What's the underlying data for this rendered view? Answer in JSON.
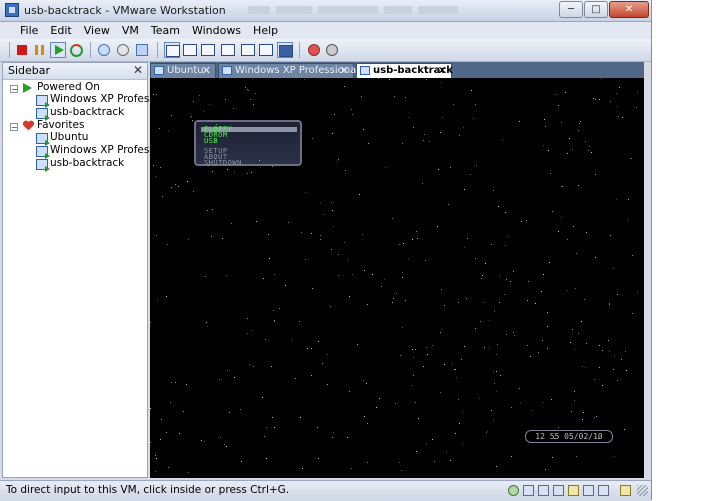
{
  "window": {
    "title": "usb-backtrack - VMware Workstation",
    "controls": {
      "minimize": "─",
      "maximize": "□",
      "close": "✕"
    }
  },
  "menubar": [
    "File",
    "Edit",
    "View",
    "VM",
    "Team",
    "Windows",
    "Help"
  ],
  "toolbar": {
    "icons": [
      "stop-icon",
      "pause-icon",
      "play-icon",
      "reset-icon",
      "snapshot-icon",
      "revert-snapshot-icon",
      "snapshot-manager-icon",
      "sidebar-view-icon",
      "fullscreen-icon",
      "quick-switch-icon",
      "console-view-icon",
      "summary-view-icon",
      "appliance-view-icon",
      "team-icon",
      "settings-icon"
    ]
  },
  "sidebar": {
    "title": "Sidebar",
    "close": "✕",
    "groups": [
      {
        "label": "Powered On",
        "expander": "−",
        "items": [
          "Windows XP Professional",
          "usb-backtrack"
        ]
      },
      {
        "label": "Favorites",
        "expander": "−",
        "items": [
          "Ubuntu",
          "Windows XP Professional",
          "usb-backtrack"
        ]
      }
    ]
  },
  "tabs": [
    {
      "label": "Ubuntu",
      "close": "✕",
      "active": false
    },
    {
      "label": "Windows XP Professional",
      "close": "✕",
      "active": false
    },
    {
      "label": "usb-backtrack",
      "close": "✕",
      "active": true
    }
  ],
  "vm_screen": {
    "boot_menu": {
      "items": [
        "FLOPPY",
        "CDROM",
        "USB"
      ],
      "options": [
        "SETUP",
        "ABOUT",
        "SHUTDOWN"
      ]
    },
    "clock": "12 55 05/02/10"
  },
  "statusbar": {
    "text": "To direct input to this VM, click inside or press Ctrl+G.",
    "icons": [
      "network-icon",
      "disk-icon",
      "cdrom-icon",
      "floppy-icon",
      "usb-icon",
      "sound-icon",
      "printer-icon",
      "message-icon"
    ]
  },
  "colors": {
    "vm_background": "#000000",
    "boot_menu_highlight": "#4ef04e",
    "tab_bar": "#506887"
  }
}
